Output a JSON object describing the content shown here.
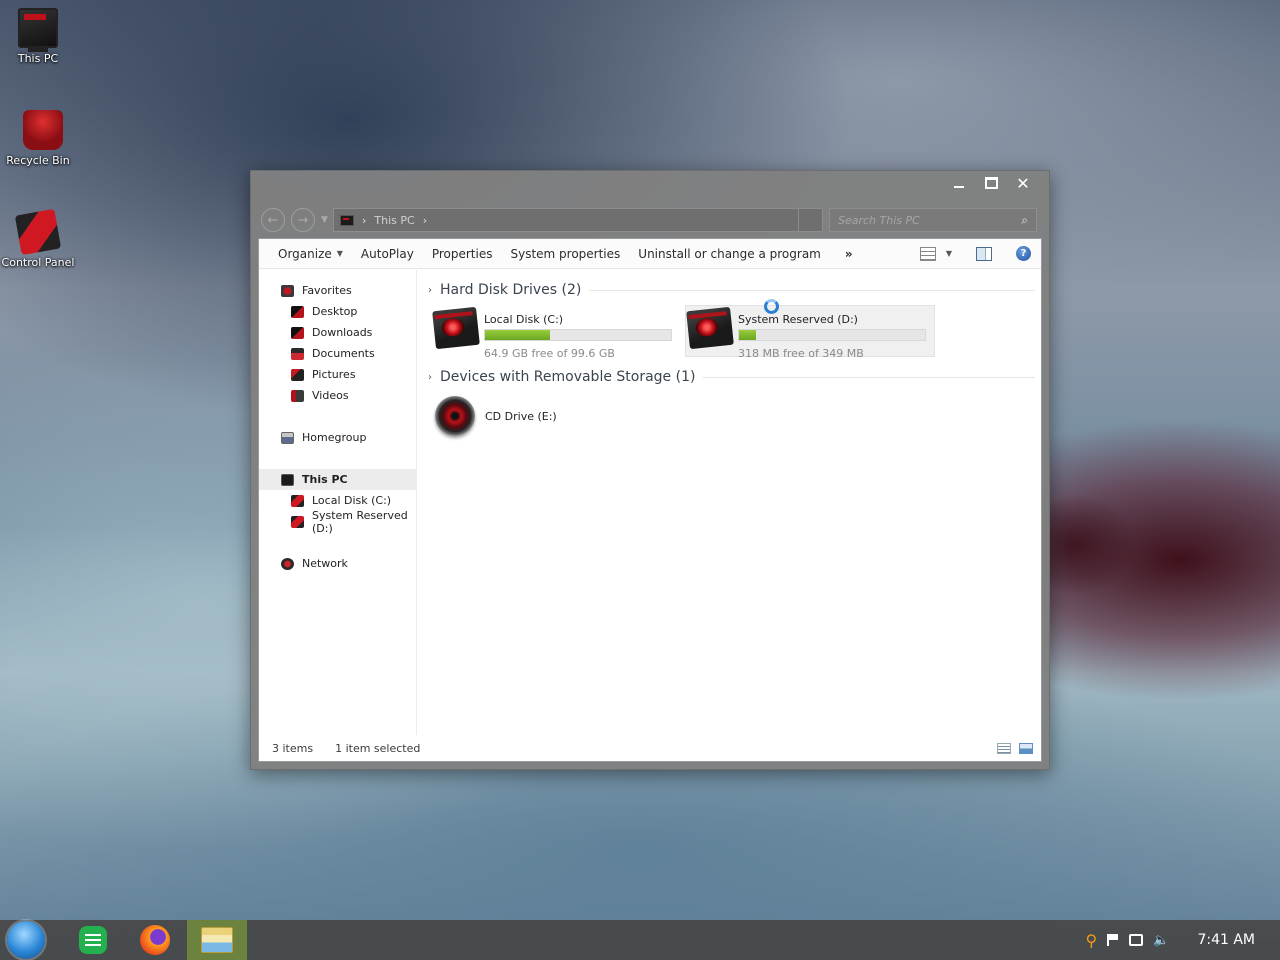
{
  "desktop": {
    "icons": [
      {
        "label": "This PC",
        "icon": "this-pc-icon"
      },
      {
        "label": "Recycle Bin",
        "icon": "recycle-bin-icon"
      },
      {
        "label": "Control Panel",
        "icon": "control-panel-icon"
      }
    ]
  },
  "window": {
    "controls": {
      "minimize": "minimize-icon",
      "maximize": "maximize-icon",
      "close": "✕"
    },
    "address": {
      "location": "This PC",
      "separator": "›"
    },
    "search": {
      "placeholder": "Search This PC",
      "icon": "⌕"
    },
    "toolbar": {
      "organize": "Organize",
      "autoplay": "AutoPlay",
      "properties": "Properties",
      "system_properties": "System properties",
      "uninstall": "Uninstall or change a program",
      "more": "»"
    },
    "sidebar": {
      "favorites": "Favorites",
      "desktop": "Desktop",
      "downloads": "Downloads",
      "documents": "Documents",
      "pictures": "Pictures",
      "videos": "Videos",
      "homegroup": "Homegroup",
      "this_pc": "This PC",
      "local_disk": "Local Disk (C:)",
      "system_reserved": "System Reserved (D:)",
      "network": "Network"
    },
    "groups": {
      "hard_disks": {
        "title": "Hard Disk Drives (2)",
        "drives": [
          {
            "name": "Local Disk (C:)",
            "free_text": "64.9 GB free of 99.6 GB",
            "used_fraction": 0.35
          },
          {
            "name": "System Reserved (D:)",
            "free_text": "318 MB free of 349 MB",
            "used_fraction": 0.09
          }
        ]
      },
      "removable": {
        "title": "Devices with Removable Storage (1)",
        "devices": [
          {
            "name": "CD Drive (E:)"
          }
        ]
      }
    },
    "status": {
      "items": "3 items",
      "selected": "1 item selected"
    }
  },
  "taskbar": {
    "clock": "7:41 AM",
    "colors": {
      "start": "#2a86d6",
      "active_app": "#78963c",
      "drive_bar": "#6aa61f"
    }
  }
}
